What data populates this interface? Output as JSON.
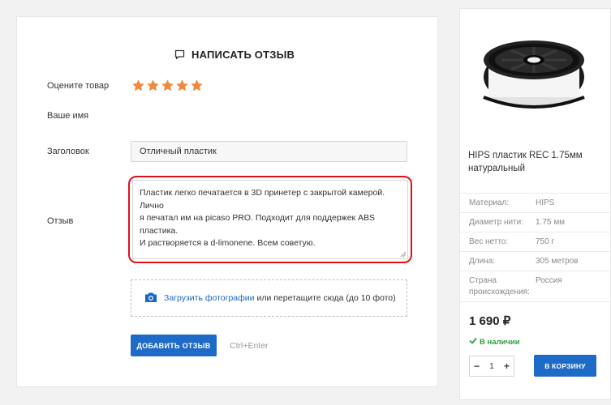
{
  "review_form": {
    "heading": "НАПИСАТЬ ОТЗЫВ",
    "rating_label": "Оцените товар",
    "rating_value": 5,
    "rating_max": 5,
    "name_label": "Ваше имя",
    "title_label": "Заголовок",
    "title_value": "Отличный пластик",
    "review_label": "Отзыв",
    "review_line1": "Пластик легко печатается в 3D принетер с закрытой камерой. Лично",
    "review_line2": "я печатал им на picaso PRO. Подходит для поддержек ABS пластика.",
    "review_line3": "И растворяется в d-limonene. Всем советую.",
    "upload_link": "Загрузить фотографии",
    "upload_rest": " или перетащите сюда (до 10 фото)",
    "submit_label": "ДОБАВИТЬ ОТЗЫВ",
    "submit_hint": "Ctrl+Enter",
    "colors": {
      "star": "#f08a3e",
      "accent": "#1d6bc6",
      "highlight": "#e0101a"
    }
  },
  "product": {
    "name": "HIPS пластик REC 1.75мм натуральный",
    "specs": [
      {
        "key": "Материал:",
        "value": "HIPS"
      },
      {
        "key": "Диаметр нити:",
        "value": "1.75 мм"
      },
      {
        "key": "Вес нетто:",
        "value": "750 г"
      },
      {
        "key": "Длина:",
        "value": "305 метров"
      },
      {
        "key": "Страна происхождения:",
        "value": "Россия"
      }
    ],
    "price": "1 690 ₽",
    "stock": "В наличии",
    "quantity": "1",
    "qty_minus": "−",
    "qty_plus": "+",
    "cart_label": "В КОРЗИНУ"
  }
}
